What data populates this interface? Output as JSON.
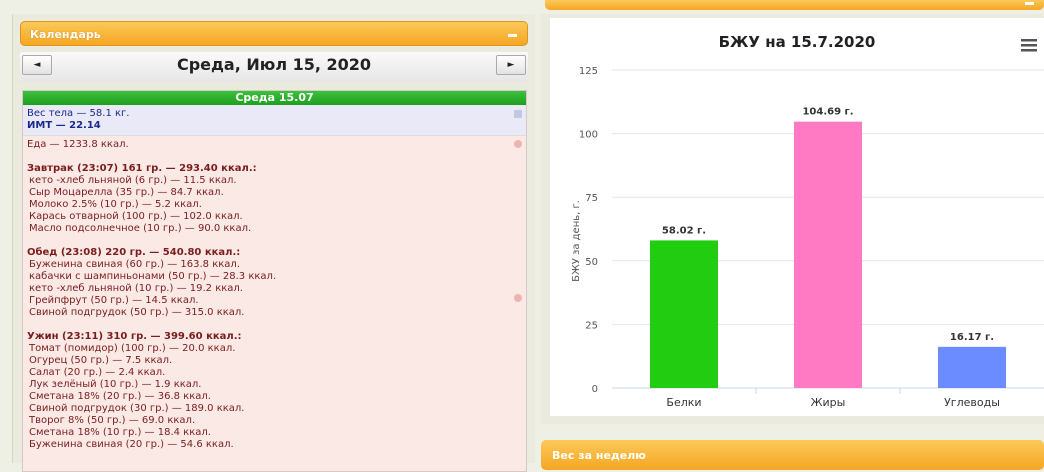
{
  "calendar_panel": {
    "title": "Календарь"
  },
  "calendar_nav": {
    "prev": "◄",
    "next": "►",
    "date_title": "Среда, Июл 15, 2020"
  },
  "day": {
    "header": "Среда 15.07",
    "weight": "Вес тела — 58.1 кг.",
    "bmi": "ИМТ — 22.14",
    "food_total": "Еда — 1233.8 ккал.",
    "meals": [
      {
        "title": "Завтрак (23:07) 161 гр. — 293.40 ккал.:",
        "items": [
          "кето -хлеб льняной (6 гр.) — 11.5 ккал.",
          "Сыр Моцарелла (35 гр.) — 84.7 ккал.",
          "Молоко 2.5% (10 гр.) — 5.2 ккал.",
          "Карась отварной (100 гр.) — 102.0 ккал.",
          "Масло подсолнечное (10 гр.) — 90.0 ккал."
        ]
      },
      {
        "title": "Обед (23:08) 220 гр. — 540.80 ккал.:",
        "items": [
          "Буженина свиная (60 гр.) — 163.8 ккал.",
          "кабачки с шампиньонами (50 гр.) — 28.3 ккал.",
          "кето -хлеб льняной (10 гр.) — 19.2 ккал.",
          "Грейпфрут (50 гр.) — 14.5 ккал.",
          "Свиной подгрудок (50 гр.) — 315.0 ккал."
        ]
      },
      {
        "title": "Ужин (23:11) 310 гр. — 399.60 ккал.:",
        "items": [
          "Томат (помидор) (100 гр.) — 20.0 ккал.",
          "Огурец (50 гр.) — 7.5 ккал.",
          "Салат (20 гр.) — 2.4 ккал.",
          "Лук зелёный (10 гр.) — 1.9 ккал.",
          "Сметана 18% (20 гр.) — 36.8 ккал.",
          "Свиной подгрудок (30 гр.) — 189.0 ккал.",
          "Творог 8% (50 гр.) — 69.0 ккал.",
          "Сметана 18% (10 гр.) — 18.4 ккал.",
          "Буженина свиная (20 гр.) — 54.6 ккал."
        ]
      }
    ]
  },
  "weekly_panel": {
    "title": "Вес за неделю"
  },
  "colors": {
    "header_orange": "#f5a623",
    "day_green": "#22aa22"
  },
  "chart_data": {
    "type": "bar",
    "title": "БЖУ на 15.7.2020",
    "ylabel": "БЖУ за день, г.",
    "xlabel": "",
    "ylim": [
      0,
      125
    ],
    "yticks": [
      0,
      25,
      50,
      75,
      100,
      125
    ],
    "categories": [
      "Белки",
      "Жиры",
      "Углеводы"
    ],
    "values": [
      58.02,
      104.69,
      16.17
    ],
    "data_labels": [
      "58.02 г.",
      "104.69 г.",
      "16.17 г."
    ],
    "colors": [
      "#22cc11",
      "#ff7ac2",
      "#6a8cff"
    ],
    "grid": true,
    "menu_icon": "hamburger-menu-icon"
  }
}
